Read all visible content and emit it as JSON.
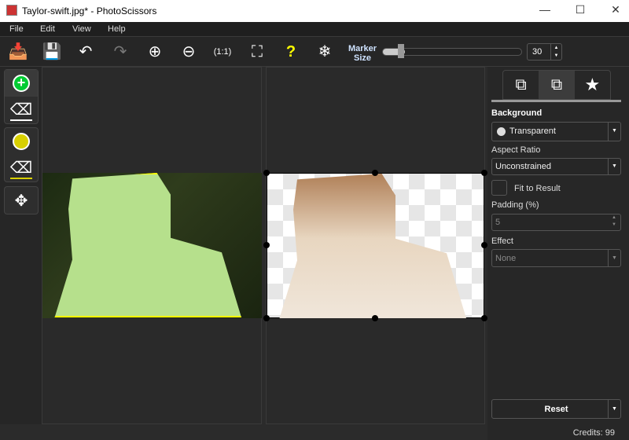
{
  "window": {
    "title": "Taylor-swift.jpg* - PhotoScissors",
    "controls": [
      "minimize",
      "maximize",
      "close"
    ]
  },
  "menu": [
    "File",
    "Edit",
    "View",
    "Help"
  ],
  "toolbar": {
    "icons": [
      "open-icon",
      "save-icon",
      "undo-icon",
      "redo-icon",
      "zoom-in-icon",
      "zoom-out-icon",
      "zoom-actual-icon",
      "zoom-fit-icon",
      "help-icon",
      "network-icon"
    ],
    "marker_label_1": "Marker",
    "marker_label_2": "Size",
    "marker_value": "30",
    "marker_fraction": 0.08
  },
  "left_tools": [
    "add-foreground-marker",
    "eraser",
    "background-marker",
    "background-eraser",
    "move"
  ],
  "panel": {
    "tabs": [
      "foreground-tab",
      "background-tab",
      "effects-tab"
    ],
    "background_label": "Background",
    "background_value": "Transparent",
    "aspect_label": "Aspect Ratio",
    "aspect_value": "Unconstrained",
    "fit_label": "Fit to Result",
    "fit_checked": false,
    "padding_label": "Padding (%)",
    "padding_value": "5",
    "effect_label": "Effect",
    "effect_value": "None",
    "reset_label": "Reset",
    "credits": "Credits: 99"
  },
  "colors": {
    "foreground_marker": "#00cc33",
    "background_marker": "#d8d000",
    "accent": "#ffff00"
  }
}
